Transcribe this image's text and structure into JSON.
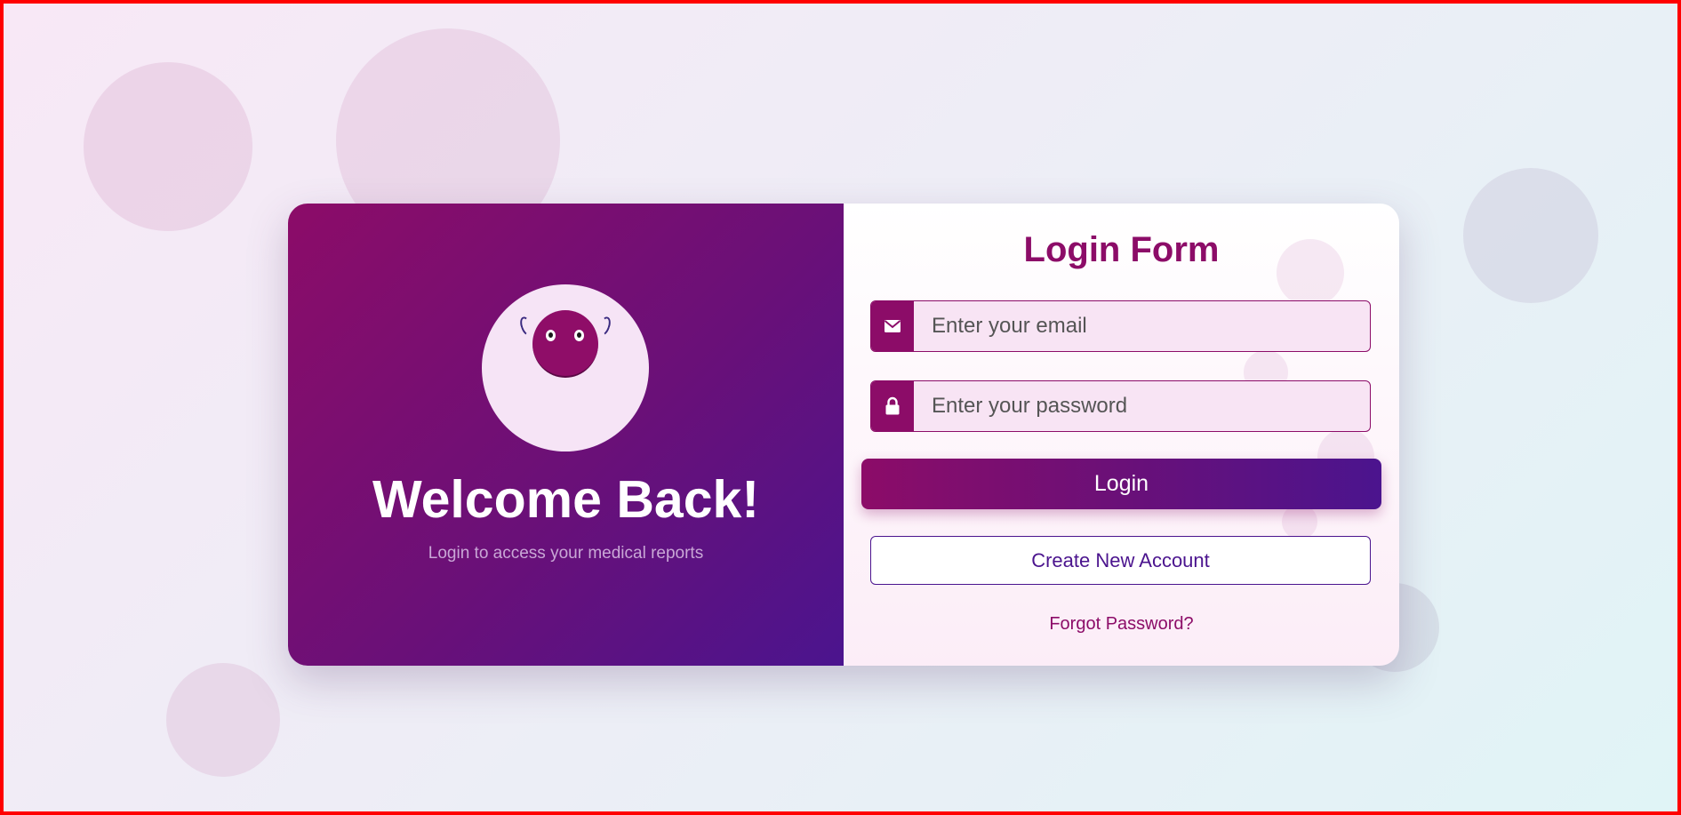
{
  "welcome_panel": {
    "title": "Welcome Back!",
    "subtitle": "Login to access your medical reports"
  },
  "login_form": {
    "title": "Login Form",
    "email": {
      "icon": "envelope-icon",
      "placeholder": "Enter your email",
      "value": ""
    },
    "password": {
      "icon": "lock-icon",
      "placeholder": "Enter your password",
      "value": ""
    },
    "login_label": "Login",
    "create_account_label": "Create New Account",
    "forgot_password_label": "Forgot Password?"
  },
  "colors": {
    "primary": "#8c0c68",
    "secondary": "#4b148e",
    "avatar_bg": "#f6e4f6",
    "input_bg": "#f8e4f4"
  }
}
